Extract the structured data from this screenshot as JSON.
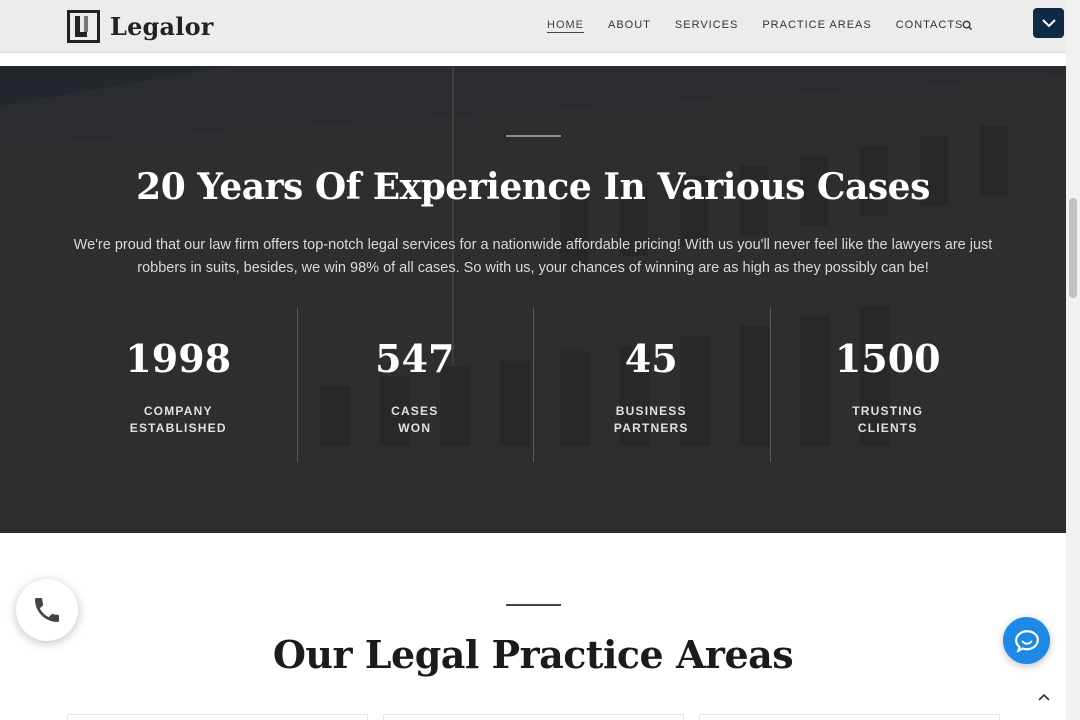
{
  "brand": {
    "name": "Legalor"
  },
  "nav": {
    "items": [
      {
        "label": "HOME",
        "active": true
      },
      {
        "label": "ABOUT",
        "active": false
      },
      {
        "label": "SERVICES",
        "active": false
      },
      {
        "label": "PRACTICE AREAS",
        "active": false
      },
      {
        "label": "CONTACTS",
        "active": false
      }
    ],
    "search_icon": "search-icon",
    "dropdown_icon": "chevron-down-icon"
  },
  "hero": {
    "title": "20 Years Of Experience In Various Cases",
    "description": "We're proud that our law firm offers top-notch legal services for a nationwide affordable pricing! With us you'll never feel like the lawyers are just robbers in suits, besides, we win 98% of all cases. So with us, your chances of winning are as high as they possibly can be!",
    "stats": [
      {
        "number": "1998",
        "label_line1": "COMPANY",
        "label_line2": "ESTABLISHED"
      },
      {
        "number": "547",
        "label_line1": "CASES",
        "label_line2": "WON"
      },
      {
        "number": "45",
        "label_line1": "BUSINESS",
        "label_line2": "PARTNERS"
      },
      {
        "number": "1500",
        "label_line1": "TRUSTING",
        "label_line2": "CLIENTS"
      }
    ]
  },
  "practice": {
    "title": "Our Legal Practice Areas"
  },
  "widgets": {
    "call_icon": "phone-icon",
    "chat_icon": "chat-icon",
    "scroll_top_icon": "chevron-up-icon"
  },
  "colors": {
    "accent_dark": "#0e2a47",
    "chat_blue": "#1e88e5"
  }
}
